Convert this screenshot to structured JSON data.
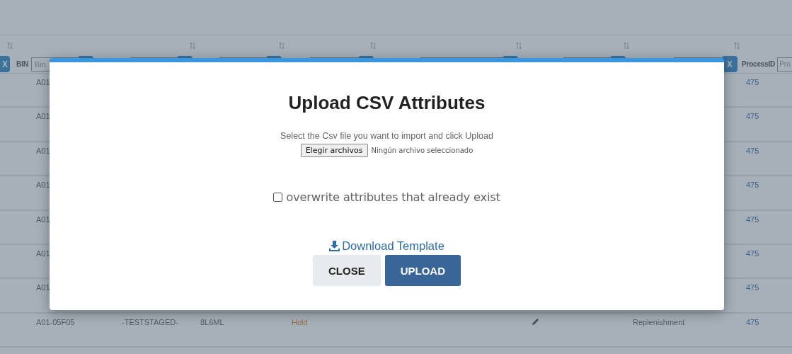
{
  "table": {
    "filter_row": [
      {
        "kind": "clear",
        "label": "X"
      },
      {
        "kind": "label",
        "text": "BIN"
      },
      {
        "kind": "field",
        "placeholder": "Bin"
      },
      {
        "kind": "clear"
      },
      {
        "kind": "field"
      },
      {
        "kind": "clear"
      },
      {
        "kind": "field"
      },
      {
        "kind": "clear"
      },
      {
        "kind": "field"
      },
      {
        "kind": "clear"
      },
      {
        "kind": "field"
      },
      {
        "kind": "clear"
      },
      {
        "kind": "field"
      },
      {
        "kind": "clear"
      },
      {
        "kind": "field"
      },
      {
        "kind": "clear",
        "label": "X"
      },
      {
        "kind": "label",
        "text": "ProcessID"
      },
      {
        "kind": "field",
        "placeholder": "Pro"
      }
    ],
    "rows": [
      {
        "bin": "A01",
        "process_id": "475"
      },
      {
        "bin": "A01",
        "process_id": "475"
      },
      {
        "bin": "A01",
        "process_id": "475"
      },
      {
        "bin": "A01",
        "process_id": "475"
      },
      {
        "bin": "A01",
        "process_id": "475"
      },
      {
        "bin": "A01",
        "process_id": "475"
      },
      {
        "bin": "A01",
        "process_id": "475"
      },
      {
        "bin": "A01-05F05",
        "column_2": "-TESTSTAGED-",
        "column_3": "8L6ML",
        "status": "Hold",
        "edit": true,
        "column_6": "Replenishment",
        "process_id": "475"
      }
    ]
  },
  "dialog": {
    "title": "Upload CSV Attributes",
    "instruction": "Select the Csv file you want to import and click Upload",
    "file_button": "Elegir archivos",
    "file_status": "Ningún archivo seleccionado",
    "overwrite": {
      "label": "overwrite attributes that already exist",
      "checked": false
    },
    "download_link": "Download Template",
    "buttons": [
      {
        "kind": "secondary",
        "label": "CLOSE"
      },
      {
        "kind": "primary",
        "label": "UPLOAD"
      }
    ]
  }
}
